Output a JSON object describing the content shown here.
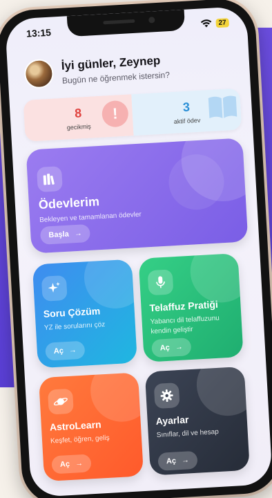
{
  "status_bar": {
    "time": "13:15",
    "battery": "27"
  },
  "header": {
    "greeting": "İyi günler, Zeynep",
    "subtitle": "Bugün ne öğrenmek istersin?"
  },
  "stats": {
    "late": {
      "value": "8",
      "label": "gecikmiş"
    },
    "active": {
      "value": "3",
      "label": "aktif ödev"
    }
  },
  "cards": {
    "odevlerim": {
      "title": "Ödevlerim",
      "subtitle": "Bekleyen ve tamamlanan ödevler",
      "button": "Başla"
    },
    "soru": {
      "title": "Soru Çözüm",
      "subtitle": "YZ ile sorularını çöz",
      "button": "Aç"
    },
    "telaffuz": {
      "title": "Telaffuz Pratiği",
      "subtitle": "Yabancı dil telaffuzunu kendin geliştir",
      "button": "Aç"
    },
    "astro": {
      "title": "AstroLearn",
      "subtitle": "Keşfet, öğren, geliş",
      "button": "Aç"
    },
    "ayarlar": {
      "title": "Ayarlar",
      "subtitle": "Sınıflar, dil ve hesap",
      "button": "Aç"
    }
  },
  "colors": {
    "background_purple": "#6c4ee0",
    "card_odev": "#8a6cf0",
    "card_soru": "#2fa3ea",
    "card_telaffuz": "#2fc07c",
    "card_astro": "#ff6a35",
    "card_ayarlar": "#303746"
  },
  "icons": {
    "odev": "books-icon",
    "soru": "sparkles-icon",
    "telaffuz": "microphone-icon",
    "astro": "planet-icon",
    "ayarlar": "gear-icon"
  }
}
